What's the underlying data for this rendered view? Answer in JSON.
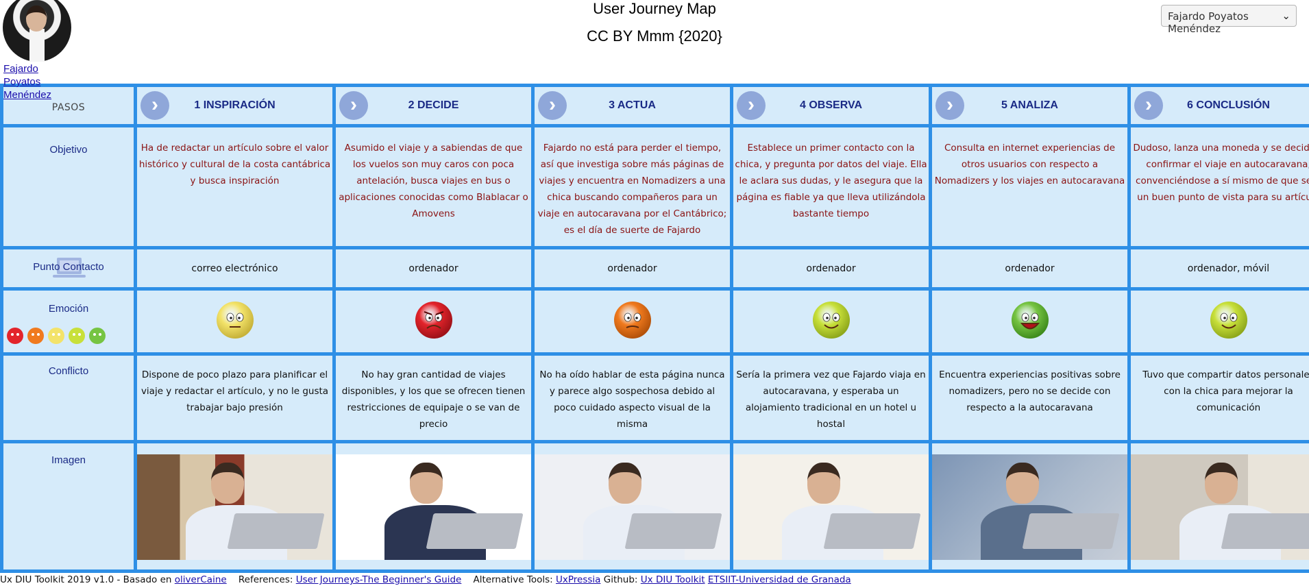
{
  "header": {
    "title": "User Journey Map",
    "subtitle": "CC BY Mmm {2020}",
    "user_link": "Fajardo Poyatos Menéndez",
    "persona_select": "Fajardo Poyatos Menéndez"
  },
  "rows": {
    "pasos": "PASOS",
    "objetivo": "Objetivo",
    "contacto": "Punto Contacto",
    "emocion": "Emoción",
    "conflicto": "Conflicto",
    "imagen": "Imagen"
  },
  "steps": [
    {
      "title": "1 INSPIRACIÓN",
      "objetivo": "Ha de redactar un artículo sobre el valor histórico y cultural de la costa cantábrica y busca inspiración",
      "contacto": "correo electrónico",
      "emotion": "neutral",
      "conflicto": "Dispone de poco plazo para planificar el viaje y redactar el artículo, y no le gusta trabajar bajo presión"
    },
    {
      "title": "2 DECIDE",
      "objetivo": "Asumido el viaje y a sabiendas de que los vuelos son muy caros con poca antelación, busca viajes en bus o aplicaciones conocidas como Blablacar o Amovens",
      "contacto": "ordenador",
      "emotion": "angry",
      "conflicto": "No hay gran cantidad de viajes disponibles, y los que se ofrecen tienen restricciones de equipaje o se van de precio"
    },
    {
      "title": "3 ACTUA",
      "objetivo": "Fajardo no está para perder el tiempo, así que investiga sobre más páginas de viajes y encuentra en Nomadizers a una chica buscando compañeros para un viaje en autocaravana por el Cantábrico; es el día de suerte de Fajardo",
      "contacto": "ordenador",
      "emotion": "annoyed",
      "conflicto": "No ha oído hablar de esta página nunca y parece algo sospechosa debido al poco cuidado aspecto visual de la misma"
    },
    {
      "title": "4 OBSERVA",
      "objetivo": "Establece un primer contacto con la chica, y pregunta por datos del viaje. Ella le aclara sus dudas, y le asegura que la página es fiable ya que lleva utilizándola bastante tiempo",
      "contacto": "ordenador",
      "emotion": "pleased",
      "conflicto": "Sería la primera vez que Fajardo viaja en autocaravana, y esperaba un alojamiento tradicional en un hotel u hostal"
    },
    {
      "title": "5 ANALIZA",
      "objetivo": "Consulta en internet experiencias de otros usuarios con respecto a Nomadizers y los viajes en autocaravana",
      "contacto": "ordenador",
      "emotion": "happy",
      "conflicto": "Encuentra experiencias positivas sobre nomadizers, pero no se decide con respecto a la autocaravana"
    },
    {
      "title": "6 CONCLUSIÓN",
      "objetivo": "Dudoso, lanza una moneda y se decide a confirmar el viaje en autocaravana, convenciéndose a sí mismo de que será un buen punto de vista para su artículo",
      "contacto": "ordenador, móvil",
      "emotion": "pleased",
      "conflicto": "Tuvo que compartir datos personales con la chica para mejorar la comunicación"
    }
  ],
  "colors": {
    "grid_border": "#2e8fe6",
    "cell_bg": "#d6ebfa",
    "header_text": "#1a2a86",
    "objetivo_text": "#8a1212",
    "chevron_bg": "#8fa7d9"
  },
  "footer": {
    "prefix": "Ux DIU Toolkit 2019 v1.0 - Basado en",
    "link1": "oliverCaine",
    "refs_label": "References:",
    "link2": "User Journeys-The Beginner's Guide",
    "alt_label": "Alternative Tools:",
    "link3": "UxPressia",
    "github_label": "Github:",
    "link4": "Ux DIU Toolkit",
    "link5": "ETSIIT-Universidad de Granada"
  }
}
